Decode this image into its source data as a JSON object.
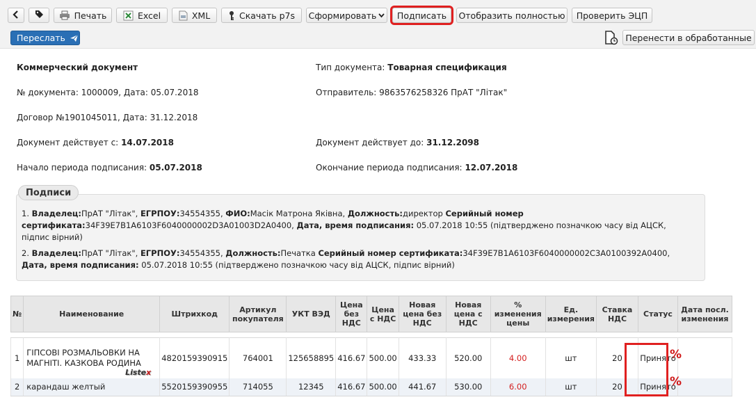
{
  "toolbar": {
    "print_label": "Печать",
    "excel_label": "Excel",
    "xml_label": "XML",
    "download_label": "Скачать p7s",
    "generate_label": "Сформировать",
    "sign_label": "Подписать",
    "show_full_label": "Отобразить полностью",
    "verify_label": "Проверить ЭЦП",
    "forward_label": "Переслать",
    "move_label": "Перенести в обработанные",
    "highlight_color": "#e02020",
    "forward_color": "#2a6fb5"
  },
  "doc": {
    "title": "Коммерческий документ",
    "number_label": "№ документа: 1000009, Дата: 05.07.2018",
    "contract_label": "Договор №1901045011, Дата: 31.12.2018",
    "valid_from_label": "Документ действует с:",
    "valid_from": "14.07.2018",
    "signing_start_label": "Начало периода подписания:",
    "signing_start": "05.07.2018",
    "type_label": "Тип документа:",
    "type": "Товарная спецификация",
    "sender_label": "Отправитель: 9863576258326 ПрАТ \"Лiтак\"",
    "valid_to_label": "Документ действует до:",
    "valid_to": "31.12.2098",
    "signing_end_label": "Окончание периода подписания:",
    "signing_end": "12.07.2018"
  },
  "signatures": {
    "legend": "Подписи",
    "s1": {
      "n": "1.",
      "owner_l": "Владелец:",
      "owner": "ПрАТ \"Лiтак\",",
      "edrpou_l": "ЕГРПОУ:",
      "edrpou": "34554355,",
      "fio_l": "ФИО:",
      "fio": "Масiк Матрона Якiвна,",
      "post_l": "Должность:",
      "post": "директор",
      "serial_l": "Серийный номер сертификата:",
      "serial": "34F39E7B1A6103F6040000002D3A01003D2A0400,",
      "dt_l": "Дата, время подписания:",
      "dt": "05.07.2018 10:55 (підтверджено позначкою часу від АЦСК, підпис вірний)"
    },
    "s2": {
      "n": "2.",
      "owner_l": "Владелец:",
      "owner": "ПрАТ \"Лiтак\",",
      "edrpou_l": "ЕГРПОУ:",
      "edrpou": "34554355,",
      "post_l": "Должность:",
      "post": "Печатка",
      "serial_l": "Серийный номер сертификата:",
      "serial": "34F39E7B1A6103F6040000002C3A0100392A0400,",
      "dt_l": "Дата, время подписания:",
      "dt": "05.07.2018 10:55 (підтверджено позначкою часу від АЦСК, підпис вірний)"
    }
  },
  "table": {
    "headers": [
      "№",
      "Наименование",
      "Штрихкод",
      "Артикул покупателя",
      "УКТ ВЭД",
      "Цена без НДС",
      "Цена с НДС",
      "Новая цена без НДС",
      "Новая цена с НДС",
      "% изменения цены",
      "Ед. измерения",
      "Ставка НДС",
      "Статус",
      "Дата посл. изменения"
    ],
    "rows": [
      {
        "n": "1",
        "name": "ГIПСОВI РОЗМАЛЬОВКИ НА МАГНIТI. КАЗКОВА РОДИНА",
        "barcode": "4820159390915",
        "article": "764001",
        "ukt": "125658895",
        "price": "416.67",
        "price_vat": "500.00",
        "new_price": "433.33",
        "new_price_vat": "520.00",
        "pct": "4.00",
        "unit": "шт",
        "vat": "20",
        "status": "Принято",
        "date": ""
      },
      {
        "n": "2",
        "name": "карандаш желтый",
        "barcode": "5520159390955",
        "article": "714055",
        "ukt": "12345",
        "price": "416.67",
        "price_vat": "500.00",
        "new_price": "441.67",
        "new_price_vat": "530.00",
        "pct": "6.00",
        "unit": "шт",
        "vat": "20",
        "status": "Принято",
        "date": ""
      }
    ],
    "pct_color": "#d42020"
  },
  "listex_logo": {
    "text": "Liste",
    "accent": "x"
  },
  "icons": [
    "back-icon",
    "tag-icon",
    "printer-icon",
    "excel-icon",
    "xml-file-icon",
    "key-icon",
    "chevron-down-icon",
    "send-icon",
    "file-clock-icon",
    "percent-icon"
  ]
}
